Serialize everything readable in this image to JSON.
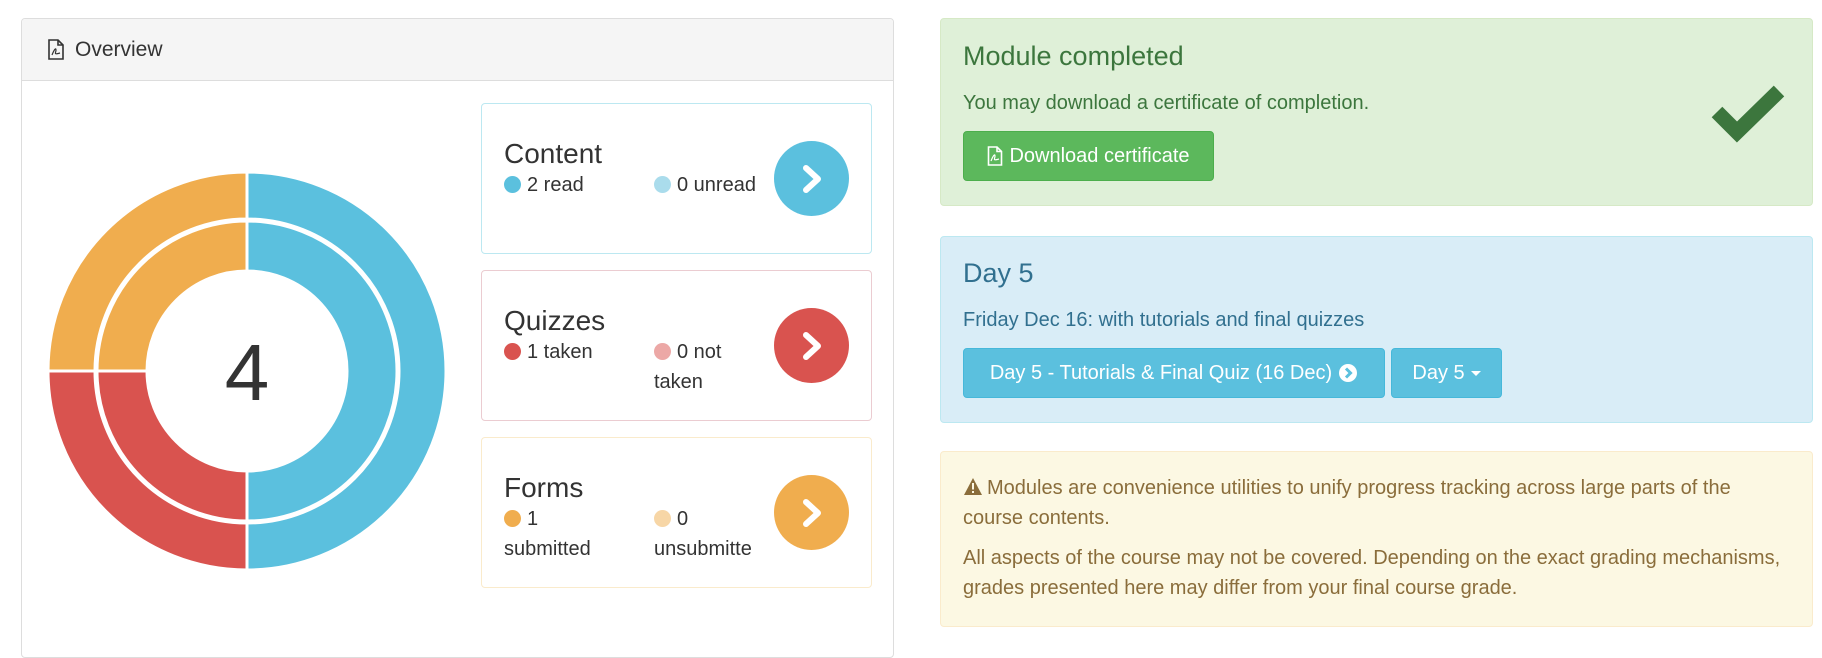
{
  "overview": {
    "title": "Overview",
    "title_icon": "file-pdf-icon",
    "total": "4",
    "chart_data": {
      "type": "pie",
      "rings": [
        {
          "name": "outer",
          "values": [
            2,
            1,
            1
          ]
        },
        {
          "name": "inner",
          "values": [
            2,
            1,
            1
          ]
        }
      ],
      "categories": [
        "Content",
        "Quizzes",
        "Forms"
      ],
      "colors": [
        "#5bc0de",
        "#d9534f",
        "#f0ad4e"
      ],
      "center_label": "4"
    },
    "cards": {
      "content": {
        "title": "Content",
        "stat_a": "2 read",
        "stat_b": "0 unread",
        "color_a": "#5bc0de",
        "color_b": "#aadcec",
        "button_color": "#5bc0de",
        "button_icon": "chevron-right-icon"
      },
      "quizzes": {
        "title": "Quizzes",
        "stat_a": "1 taken",
        "stat_b": "0 not taken",
        "color_a": "#d9534f",
        "color_b": "#eca8a6",
        "button_color": "#d9534f",
        "button_icon": "chevron-right-icon"
      },
      "forms": {
        "title": "Forms",
        "stat_a": "1 submitted",
        "stat_b": "0 unsubmitte",
        "color_a": "#f0ad4e",
        "color_b": "#f7d6a6",
        "button_color": "#f0ad4e",
        "button_icon": "chevron-right-icon"
      }
    }
  },
  "completion": {
    "title": "Module completed",
    "text": "You may download a certificate of completion.",
    "button": "Download certificate",
    "button_icon": "file-pdf-icon",
    "check_icon": "checkmark-icon"
  },
  "day": {
    "title": "Day 5",
    "text": "Friday Dec 16: with tutorials and final quizzes",
    "primary_button": "Day 5 - Tutorials & Final Quiz (16 Dec)",
    "primary_icon": "chevron-circle-right-icon",
    "dropdown_button": "Day 5"
  },
  "notice": {
    "icon": "warning-icon",
    "line1": "Modules are convenience utilities to unify progress tracking across large parts of the course contents.",
    "line2": "All aspects of the course may not be covered. Depending on the exact grading mechanisms, grades presented here may differ from your final course grade."
  }
}
